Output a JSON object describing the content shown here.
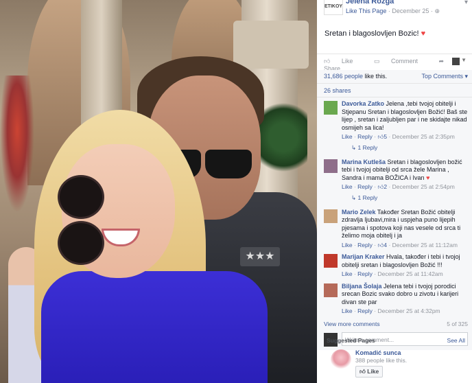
{
  "page": {
    "logo_text": "ETIKOY",
    "name": "Jelena Rozga",
    "like_link": "Like This Page",
    "separator": "·",
    "date": "December 25",
    "globe_icon": "globe-icon",
    "chevron_icon": "chevron-down-icon"
  },
  "post": {
    "text": "Sretan i blagoslovljen Bozic!",
    "heart": "♥"
  },
  "actions": {
    "like": "Like",
    "comment": "Comment",
    "share": "Share",
    "caret": "▼"
  },
  "stats": {
    "likes_count": "31,686 people",
    "likes_suffix": " like this.",
    "top_comments": "Top Comments ▾",
    "shares": "26 shares"
  },
  "comments": [
    {
      "name": "Davorka Zatko",
      "text": " Jelena ,tebi tvojoj obitelji i Stjepanu Sretan i blagoslovljen Božić! Baš ste lijep , sretan i zaljubljen par i ne skidajte nikad osmijeh sa lica!",
      "like": "Like",
      "reply": "Reply",
      "likes": "5",
      "time": "December 25 at 2:35pm",
      "replies": "1 Reply",
      "avatar_color": "#6aa84f"
    },
    {
      "name": "Marina Kutleša",
      "text": " Sretan i blagoslovljen božić tebi i tvojoj obitelji od srca žele Marina , Sandra i mama BOŽICA i Ivan",
      "heart": "♥",
      "like": "Like",
      "reply": "Reply",
      "likes": "2",
      "time": "December 25 at 2:54pm",
      "replies": "1 Reply",
      "avatar_color": "#8e6e8a"
    },
    {
      "name": "Mario Zelek",
      "text": " Također Sretan Božić obitelji zdravlja ljubavi,mira i uspjeha puno lijepih pjesama i spotova koji nas vesele od srca ti želimo moja obitelj i ja",
      "like": "Like",
      "reply": "Reply",
      "likes": "4",
      "time": "December 25 at 11:12am",
      "avatar_color": "#c9a27a"
    },
    {
      "name": "Marijan Kraker",
      "text": " Hvala, također i tebi i tvojoj obitelji sretan i blagoslovljen Božić !!!",
      "like": "Like",
      "reply": "Reply",
      "time": "December 25 at 11:42am",
      "avatar_color": "#c0392b"
    },
    {
      "name": "Biljana Šolaja",
      "text": " Jelena tebi i tvojoj porodici srecan Bozic svako dobro u zivotu i karijeri divan ste par",
      "like": "Like",
      "reply": "Reply",
      "time": "December 25 at 4:32pm",
      "avatar_color": "#b56a5a"
    }
  ],
  "more": {
    "label": "View more comments",
    "count": "5 of 325"
  },
  "write": {
    "placeholder": "Write a comment..."
  },
  "suggested": {
    "title": "Suggested Pages",
    "see_all": "See All",
    "name": "Komadić sunca",
    "likes": "388 people like this.",
    "like_btn": "Like"
  },
  "photo": {
    "pins": "★★★"
  }
}
